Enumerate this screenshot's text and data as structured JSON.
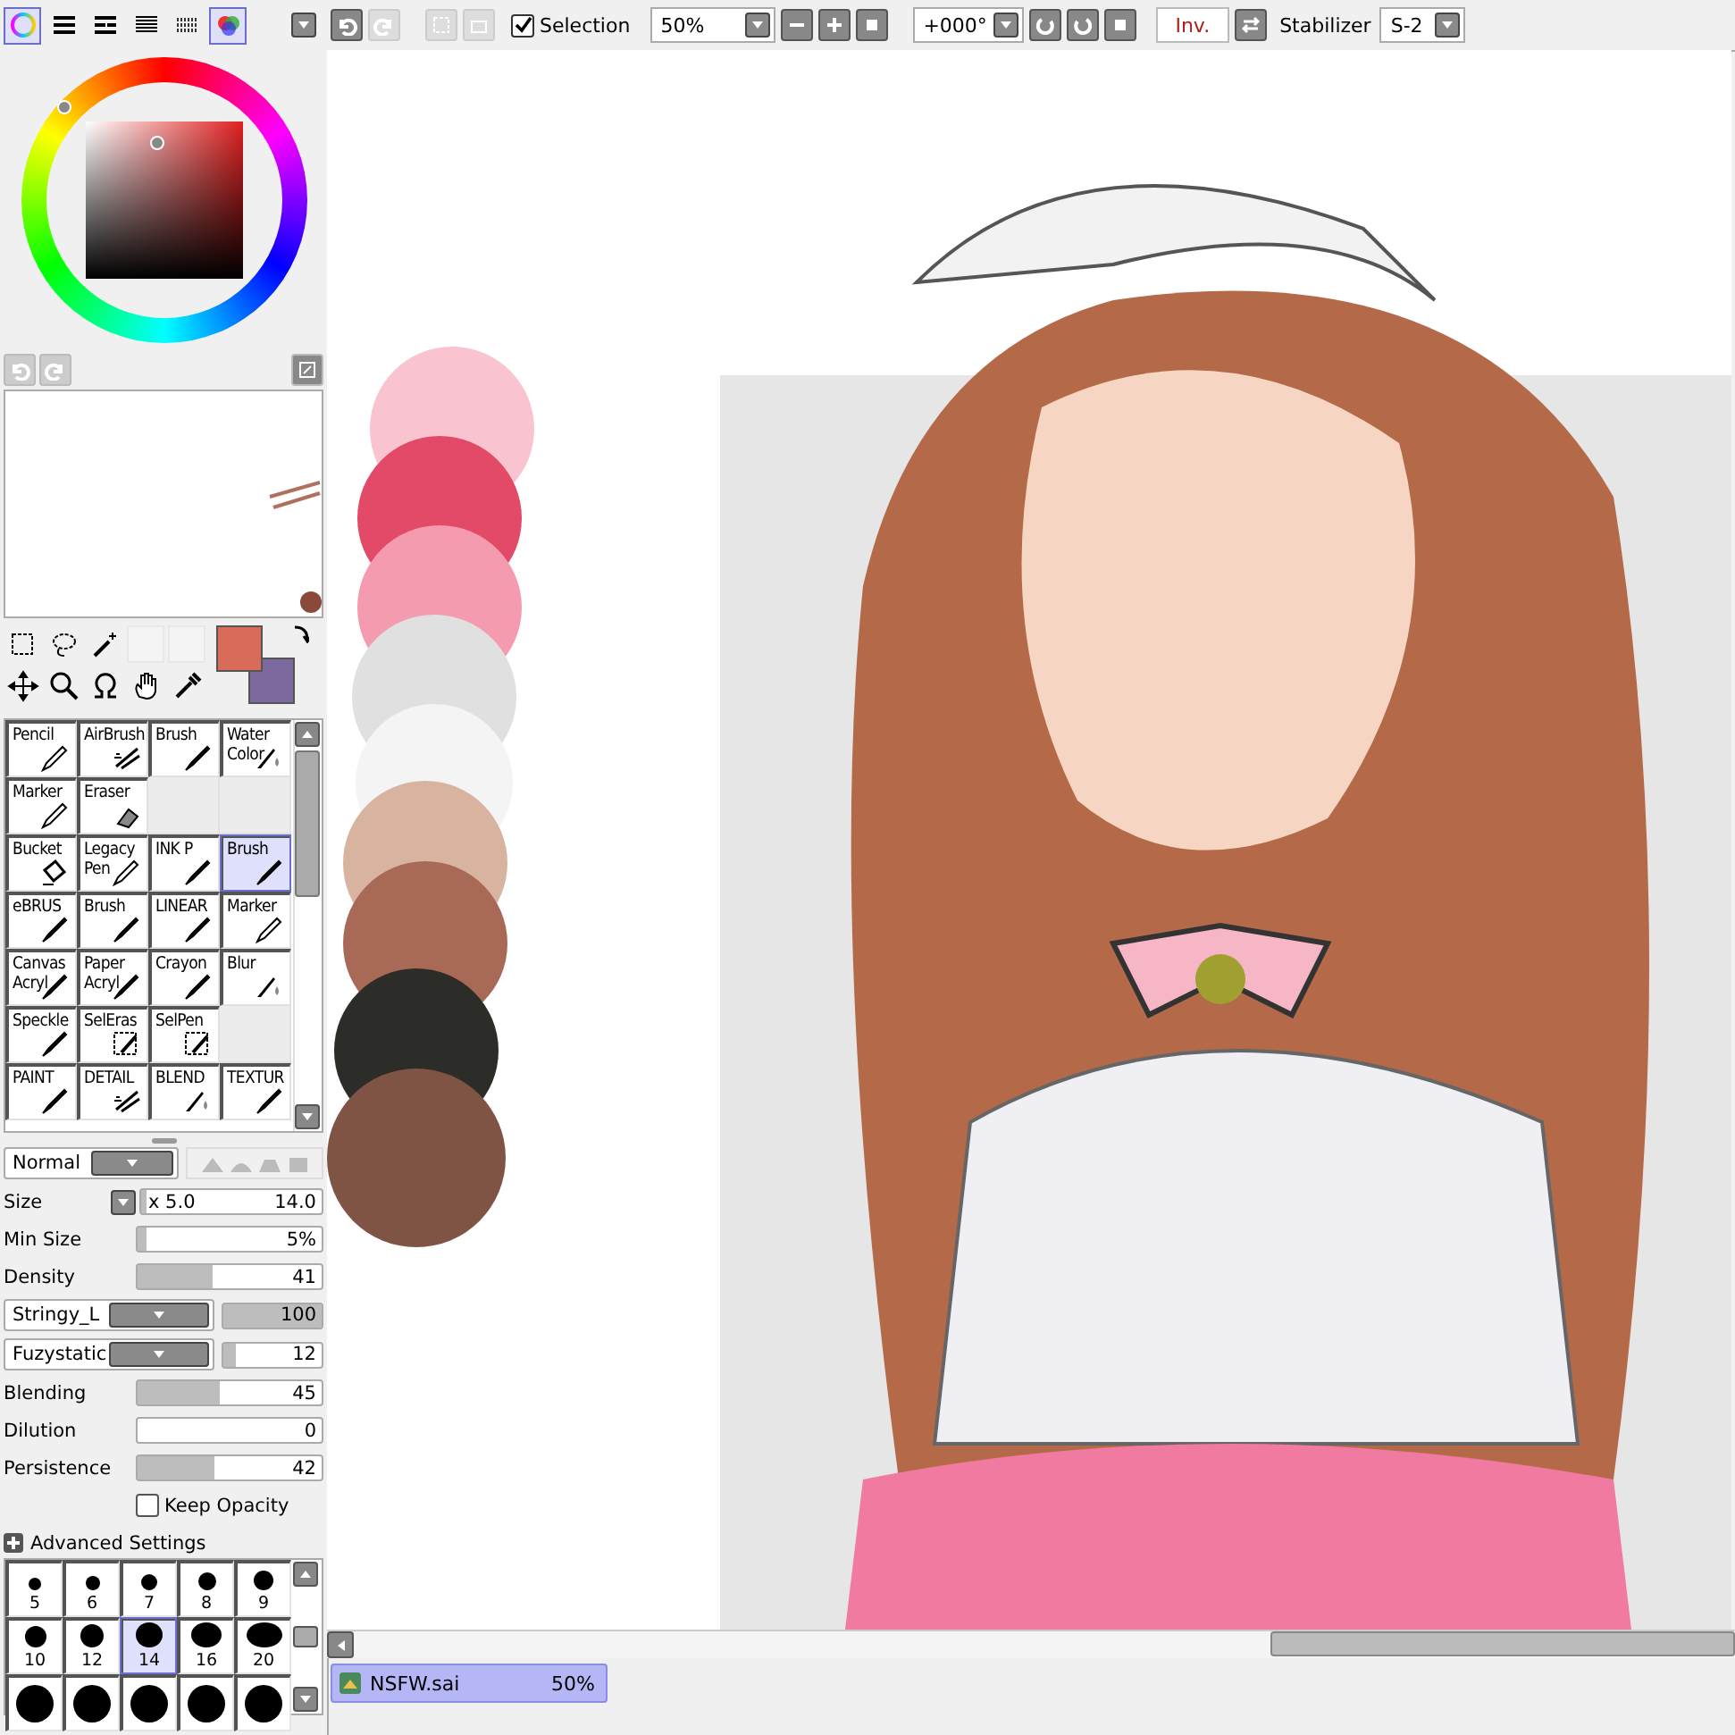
{
  "color_modes": [
    {
      "selected": true
    },
    {
      "selected": false
    },
    {
      "selected": false
    },
    {
      "selected": false
    },
    {
      "selected": false
    },
    {
      "selected": true
    }
  ],
  "toolbar": {
    "selection": {
      "label": "Selection",
      "checked": true
    },
    "zoom": "50%",
    "rotation": "+000°",
    "invert": "Inv.",
    "stabilizer_label": "Stabilizer",
    "stabilizer": "S-2"
  },
  "color_swatches": [
    {
      "color": "#d86c58"
    },
    {
      "color": "#7c6a9e"
    }
  ],
  "tools": [
    {
      "label": "Pencil",
      "kind": "pencil",
      "selected": false
    },
    {
      "label": "AirBrush",
      "kind": "airbrush",
      "selected": false
    },
    {
      "label": "Brush",
      "kind": "brush",
      "selected": false
    },
    {
      "label": "Water Color",
      "kind": "water",
      "selected": false
    },
    {
      "label": "Marker",
      "kind": "pencil",
      "selected": false
    },
    {
      "label": "Eraser",
      "kind": "eraser",
      "selected": false
    },
    {
      "kind": "empty"
    },
    {
      "kind": "empty"
    },
    {
      "label": "Bucket",
      "kind": "bucket",
      "selected": false
    },
    {
      "label": "Legacy Pen",
      "kind": "pencil",
      "selected": false
    },
    {
      "label": "INK P",
      "kind": "brush",
      "selected": false
    },
    {
      "label": "Brush",
      "kind": "brush",
      "selected": true
    },
    {
      "label": "eBRUS",
      "kind": "brush",
      "selected": false
    },
    {
      "label": "Brush",
      "kind": "brush",
      "selected": false
    },
    {
      "label": "LINEAR",
      "kind": "brush",
      "selected": false
    },
    {
      "label": "Marker",
      "kind": "pencil",
      "selected": false
    },
    {
      "label": "Canvas Acryl",
      "kind": "brush",
      "selected": false
    },
    {
      "label": "Paper Acryl",
      "kind": "brush",
      "selected": false
    },
    {
      "label": "Crayon",
      "kind": "brush",
      "selected": false
    },
    {
      "label": "Blur",
      "kind": "water",
      "selected": false
    },
    {
      "label": "Speckle",
      "kind": "brush",
      "selected": false
    },
    {
      "label": "SelEras",
      "kind": "selection",
      "selected": false
    },
    {
      "label": "SelPen",
      "kind": "selection",
      "selected": false
    },
    {
      "kind": "empty"
    },
    {
      "label": "PAINT",
      "kind": "brush",
      "selected": false
    },
    {
      "label": "DETAIL",
      "kind": "airbrush",
      "selected": false
    },
    {
      "label": "BLEND",
      "kind": "water",
      "selected": false
    },
    {
      "label": "TEXTUR",
      "kind": "brush",
      "selected": false
    }
  ],
  "blend_mode": "Normal",
  "settings": [
    {
      "kind": "size",
      "label": "Size",
      "multiplier": "x 5.0",
      "value": "14.0",
      "level": 0.03
    },
    {
      "kind": "slider",
      "label": "Min Size",
      "value": "5%",
      "level": 0.05
    },
    {
      "kind": "slider",
      "label": "Density",
      "value": "41",
      "level": 0.41
    },
    {
      "kind": "texture",
      "option": "Stringy_L",
      "value": "100",
      "level": 1
    },
    {
      "kind": "texture",
      "option": "Fuzystatic",
      "value": "12",
      "level": 0.12
    },
    {
      "kind": "slider",
      "label": "Blending",
      "value": "45",
      "level": 0.45
    },
    {
      "kind": "slider",
      "label": "Dilution",
      "value": "0",
      "level": 0
    },
    {
      "kind": "slider",
      "label": "Persistence",
      "value": "42",
      "level": 0.42
    },
    {
      "kind": "checkbox",
      "label": "Keep Opacity",
      "checked": false
    },
    {
      "kind": "expander",
      "label": "Advanced Settings"
    }
  ],
  "brush_sizes": [
    {
      "kind": "labeled",
      "size": "5",
      "selected": false
    },
    {
      "kind": "labeled",
      "size": "6",
      "selected": false
    },
    {
      "kind": "labeled",
      "size": "7",
      "selected": false
    },
    {
      "kind": "labeled",
      "size": "8",
      "selected": false
    },
    {
      "kind": "labeled",
      "size": "9",
      "selected": false
    },
    {
      "kind": "labeled",
      "size": "10",
      "selected": false
    },
    {
      "kind": "labeled",
      "size": "12",
      "selected": false
    },
    {
      "kind": "labeled",
      "size": "14",
      "selected": true
    },
    {
      "kind": "labeled",
      "size": "16",
      "selected": false
    },
    {
      "kind": "labeled",
      "size": "20",
      "selected": false
    },
    {
      "kind": "unlabeled",
      "selected": false
    },
    {
      "kind": "unlabeled",
      "selected": false
    },
    {
      "kind": "unlabeled",
      "selected": false
    },
    {
      "kind": "unlabeled",
      "selected": false
    },
    {
      "kind": "unlabeled",
      "selected": false
    }
  ],
  "file_tab": {
    "name": "NSFW.sai",
    "zoom": "50%",
    "selected": true
  }
}
